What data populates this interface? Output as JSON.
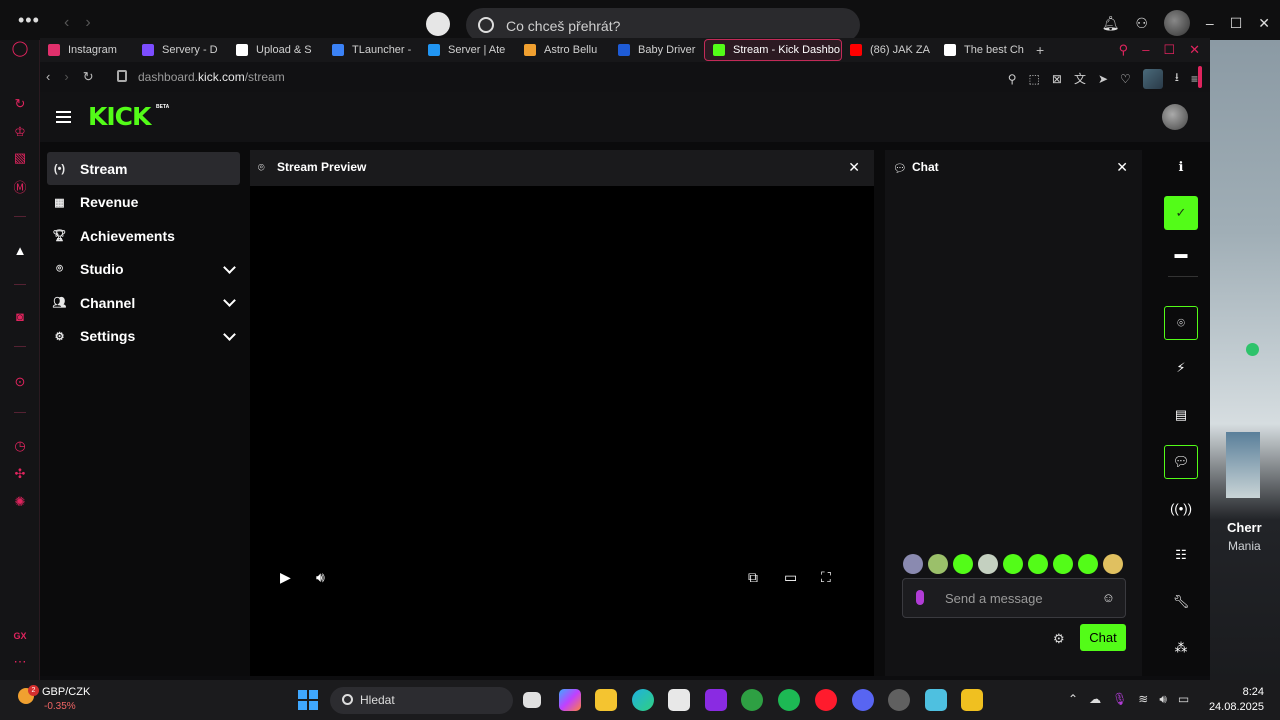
{
  "os": {
    "search_placeholder": "Co chceš přehrát?"
  },
  "browser": {
    "tabs": [
      {
        "label": "Instagram",
        "color": "#e1306c"
      },
      {
        "label": "Servery - D",
        "color": "#7c4dff"
      },
      {
        "label": "Upload & S",
        "color": "#ffffff"
      },
      {
        "label": "TLauncher -",
        "color": "#3b82f6"
      },
      {
        "label": "Server | Ate",
        "color": "#2196f3"
      },
      {
        "label": "Astro Bellu",
        "color": "#f0a030"
      },
      {
        "label": "Baby Driver",
        "color": "#1e5bd6"
      },
      {
        "label": "Stream - Kick Dashbo",
        "color": "#53fc18",
        "active": true
      },
      {
        "label": "(86) JAK ZA",
        "color": "#ff0000"
      },
      {
        "label": "The best Ch",
        "color": "#ffffff"
      }
    ],
    "url_prefix": "dashboard.",
    "url_domain": "kick.com",
    "url_path": "/stream"
  },
  "kick": {
    "logo": "KICK",
    "logo_badge": "BETA",
    "accent": "#53fc18",
    "nav": [
      {
        "label": "Stream",
        "icon": "broadcast-icon",
        "active": true
      },
      {
        "label": "Revenue",
        "icon": "chart-icon"
      },
      {
        "label": "Achievements",
        "icon": "trophy-icon"
      },
      {
        "label": "Studio",
        "icon": "studio-icon",
        "expandable": true
      },
      {
        "label": "Channel",
        "icon": "users-icon",
        "expandable": true
      },
      {
        "label": "Settings",
        "icon": "gear-icon",
        "expandable": true
      }
    ],
    "preview": {
      "title": "Stream Preview"
    },
    "chat": {
      "title": "Chat",
      "input_placeholder": "Send a message",
      "send_label": "Chat"
    }
  },
  "background_window": {
    "title": "Cherr",
    "subtitle": "Mania"
  },
  "taskbar": {
    "ticker_pair": "GBP/CZK",
    "ticker_change": "-0.35%",
    "weather_badge": "2",
    "search_placeholder": "Hledat",
    "time": "8:24",
    "date": "24.08.2025"
  }
}
